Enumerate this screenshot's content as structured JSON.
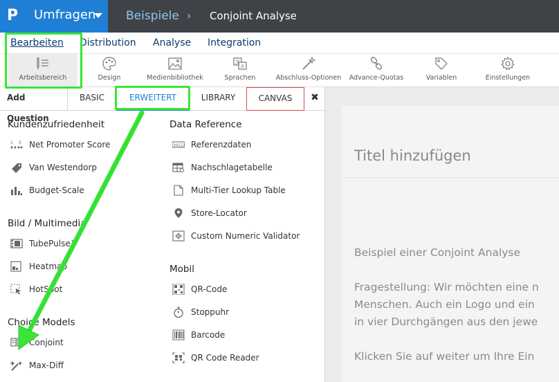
{
  "header": {
    "app_title": "Umfragen",
    "breadcrumb_1": "Beispiele",
    "breadcrumb_sep": "›",
    "breadcrumb_2": "Conjoint Analyse"
  },
  "main_tabs": [
    "Bearbeiten",
    "Distribution",
    "Analyse",
    "Integration"
  ],
  "toolbar": [
    "Arbeitsbereich",
    "Design",
    "Medienbibliothek",
    "Sprachen",
    "Abschluss-Optionen",
    "Advance-Quotas",
    "Variablen",
    "Einstellungen"
  ],
  "question_tabs": {
    "add": "Add Question",
    "basic": "BASIC",
    "erweitert": "ERWEITERT",
    "library": "LIBRARY",
    "canvas": "CANVAS",
    "close": "✖"
  },
  "sections": {
    "kunden": {
      "title": "Kundenzufriedenheit",
      "items": [
        "Net Promoter Score",
        "Van Westendorp",
        "Budget-Scale"
      ]
    },
    "bild": {
      "title": "Bild / Multimedia",
      "items": [
        "TubePulse™",
        "Heatmap",
        "HotSpot"
      ]
    },
    "choice": {
      "title": "Choice Models",
      "items": [
        "Conjoint",
        "Max-Diff"
      ]
    },
    "dataref": {
      "title": "Data Reference",
      "items": [
        "Referenzdaten",
        "Nachschlagetabelle",
        "Multi-Tier Lookup Table",
        "Store-Locator",
        "Custom Numeric Validator"
      ]
    },
    "mobil": {
      "title": "Mobil",
      "items": [
        "QR-Code",
        "Stoppuhr",
        "Barcode",
        "QR Code Reader"
      ]
    }
  },
  "canvas": {
    "title": "Titel hinzufügen",
    "line1": "Beispiel einer Conjoint Analyse",
    "line2": "Fragestellung: Wir möchten eine n",
    "line3": "Menschen. Auch ein Logo und ein",
    "line4": "in vier Durchgängen aus den jewe",
    "line5": "Klicken Sie auf weiter um Ihre Ein"
  },
  "colors": {
    "brand": "#1f7fd4",
    "topbar": "#3f4347",
    "annotation": "#39e536",
    "canvas_border": "#d94b4b"
  }
}
